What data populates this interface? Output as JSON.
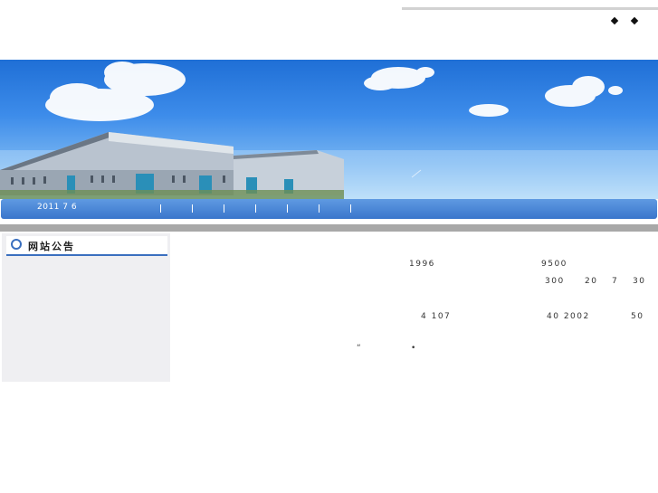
{
  "header": {
    "bullet_links": [
      "◆",
      "◆"
    ]
  },
  "nav": {
    "date": "2011  7  6",
    "separators": [
      "|",
      "|",
      "|",
      "|",
      "|",
      "|",
      "|"
    ]
  },
  "sidebar": {
    "title": "网站公告"
  },
  "content": {
    "line1": [
      "1996",
      "9500"
    ],
    "line2": [
      "300",
      "20",
      "7",
      "30"
    ],
    "line3": [
      "4  107",
      "40  2002",
      "50"
    ],
    "quote_mark": "“",
    "dot_mark": "•"
  }
}
